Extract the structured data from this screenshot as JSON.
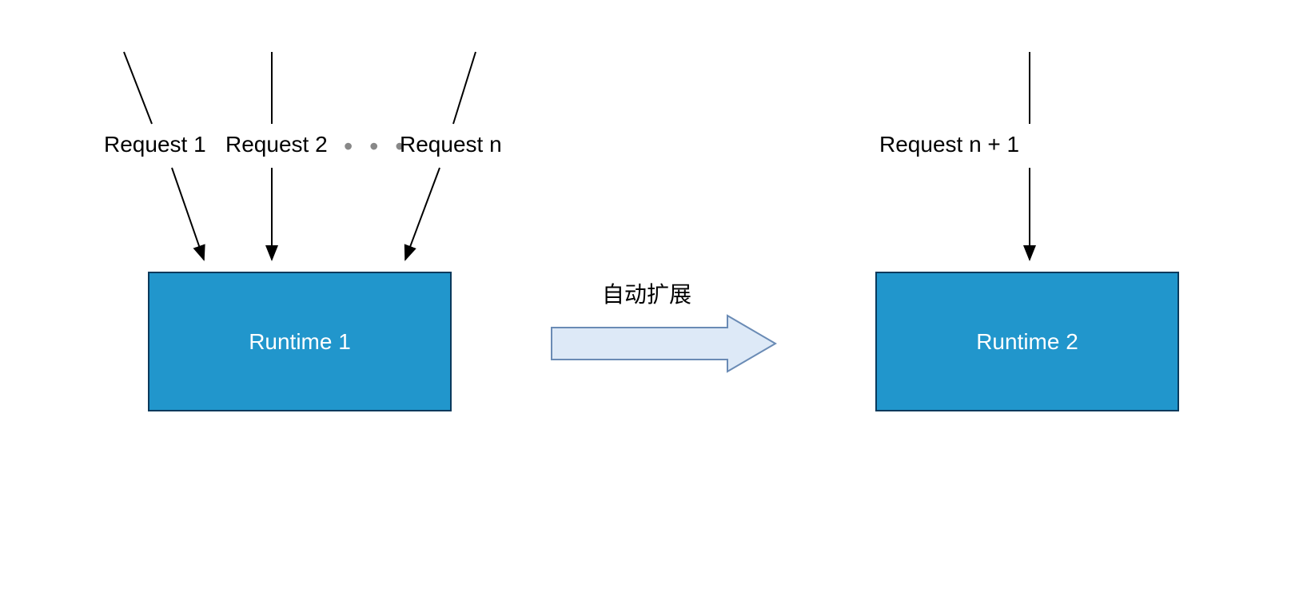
{
  "requests": {
    "req1": "Request 1",
    "req2": "Request 2",
    "reqn": "Request n",
    "reqn1": "Request n + 1",
    "ellipsis": "• • •"
  },
  "runtimes": {
    "runtime1": "Runtime 1",
    "runtime2": "Runtime 2"
  },
  "scale": {
    "label": "自动扩展"
  }
}
